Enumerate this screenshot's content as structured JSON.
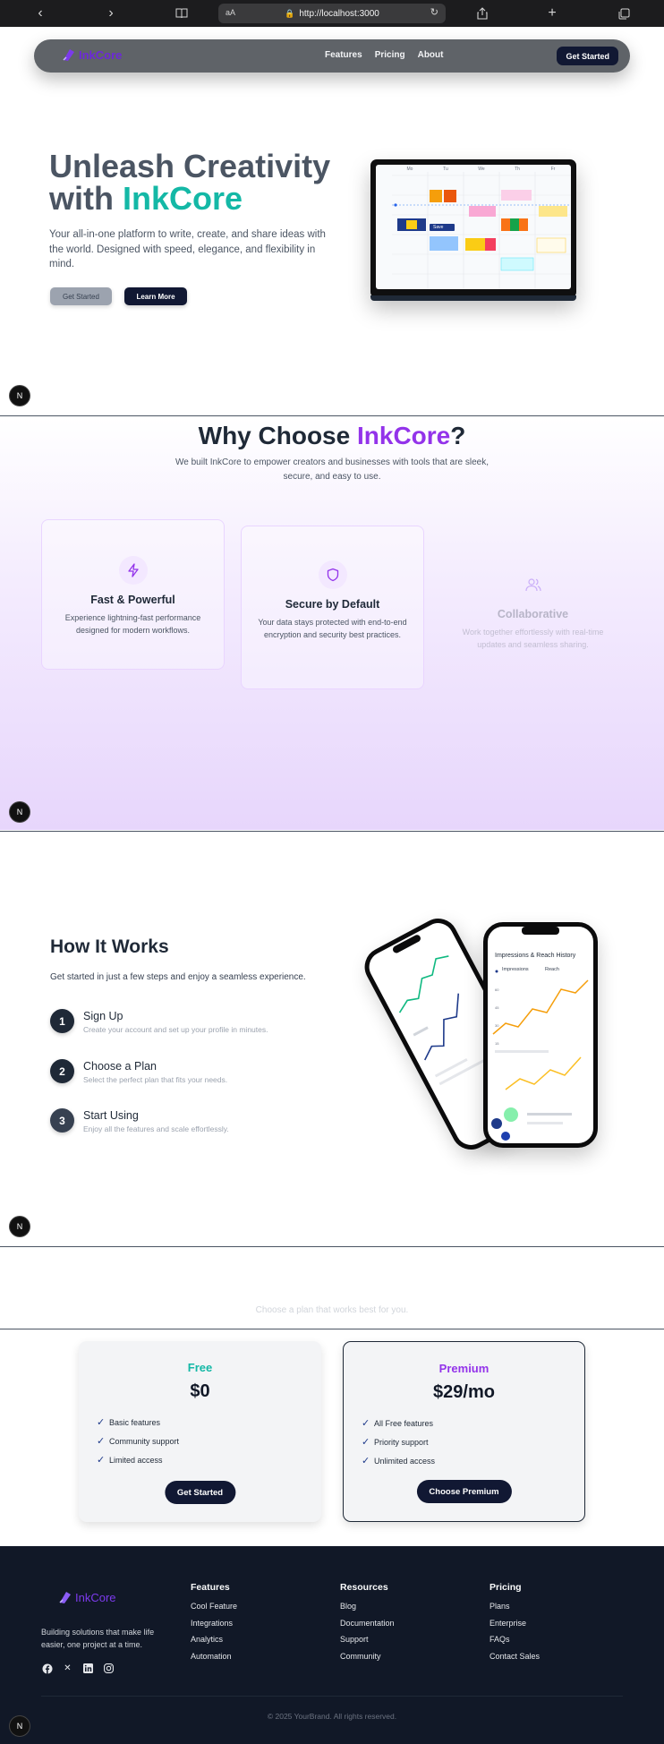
{
  "browser": {
    "url": "http://localhost:3000",
    "text_size": "aA"
  },
  "brand": {
    "name": "InkCore",
    "accent_purple": "#9333ea",
    "accent_teal": "#14b8a6",
    "navy": "#111833"
  },
  "navbar": {
    "links": [
      "Features",
      "Pricing",
      "About"
    ],
    "cta": "Get Started"
  },
  "hero": {
    "title_line1": "Unleash Creativity",
    "title_line2_prefix": "with ",
    "title_line2_accent": "InkCore",
    "description": "Your all-in-one platform to write, create, and share ideas with the world. Designed with speed, elegance, and flexibility in mind.",
    "primary_button": "Get Started",
    "secondary_button": "Learn More",
    "calendar_days": [
      "Mo",
      "Tu",
      "We",
      "Th",
      "Fr"
    ],
    "calendar_tag": "Save"
  },
  "dev_badge": "N",
  "why": {
    "title_prefix": "Why Choose ",
    "title_accent": "InkCore",
    "title_suffix": "?",
    "subtitle": "We built InkCore to empower creators and businesses with tools that are sleek, secure, and easy to use.",
    "cards": [
      {
        "icon": "lightning-icon",
        "title": "Fast & Powerful",
        "description": "Experience lightning-fast performance designed for modern workflows."
      },
      {
        "icon": "shield-icon",
        "title": "Secure by Default",
        "description": "Your data stays protected with end-to-end encryption and security best practices."
      },
      {
        "icon": "users-icon",
        "title": "Collaborative",
        "description": "Work together effortlessly with real-time updates and seamless sharing."
      }
    ]
  },
  "how": {
    "title": "How It Works",
    "subtitle": "Get started in just a few steps and enjoy a seamless experience.",
    "steps": [
      {
        "number": "1",
        "title": "Sign Up",
        "description": "Create your account and set up your profile in minutes."
      },
      {
        "number": "2",
        "title": "Choose a Plan",
        "description": "Select the perfect plan that fits your needs."
      },
      {
        "number": "3",
        "title": "Start Using",
        "description": "Enjoy all the features and scale effortlessly."
      }
    ],
    "phone_chart": {
      "title": "Impressions & Reach History",
      "legend": [
        "Impressions",
        "Reach"
      ]
    }
  },
  "pricing": {
    "subtitle": "Choose a plan that works best for you.",
    "plans": [
      {
        "name": "Free",
        "price": "$0",
        "features": [
          "Basic features",
          "Community support",
          "Limited access"
        ],
        "button": "Get Started",
        "color": "#14b8a6"
      },
      {
        "name": "Premium",
        "price": "$29/mo",
        "features": [
          "All Free features",
          "Priority support",
          "Unlimited access"
        ],
        "button": "Choose Premium",
        "color": "#9333ea"
      }
    ]
  },
  "footer": {
    "brand": "InkCore",
    "tagline": "Building solutions that make life easier, one project at a time.",
    "social": [
      "facebook-icon",
      "x-icon",
      "linkedin-icon",
      "instagram-icon"
    ],
    "columns": [
      {
        "heading": "Features",
        "links": [
          "Cool Feature",
          "Integrations",
          "Analytics",
          "Automation"
        ]
      },
      {
        "heading": "Resources",
        "links": [
          "Blog",
          "Documentation",
          "Support",
          "Community"
        ]
      },
      {
        "heading": "Pricing",
        "links": [
          "Plans",
          "Enterprise",
          "FAQs",
          "Contact Sales"
        ]
      }
    ],
    "copyright": "© 2025 YourBrand. All rights reserved."
  }
}
